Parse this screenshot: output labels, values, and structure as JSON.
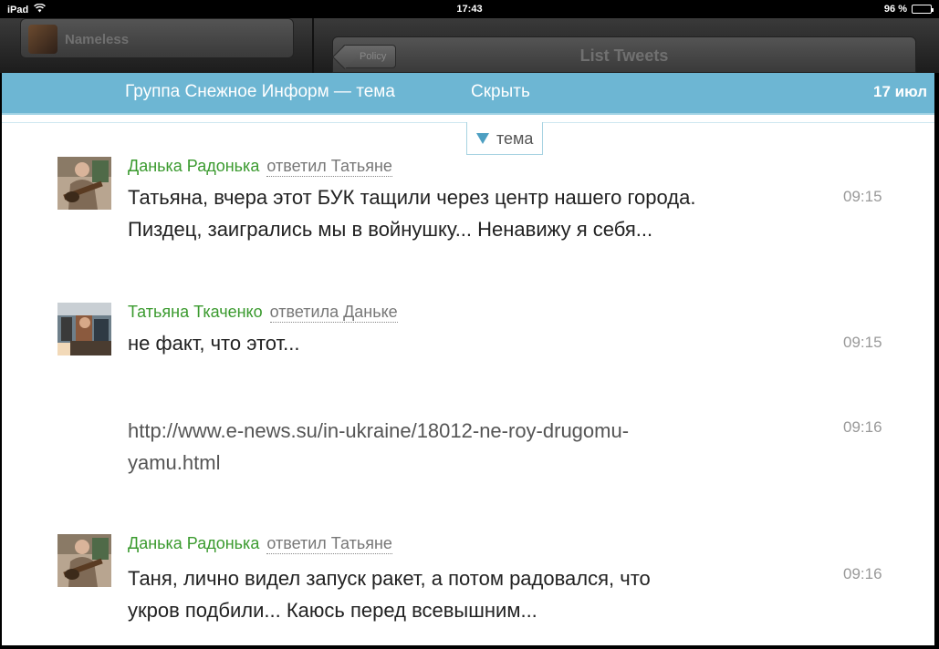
{
  "status_bar": {
    "device": "iPad",
    "time": "17:43",
    "battery": "96 %",
    "battery_level": 0.96
  },
  "background_app": {
    "left_pane_title": "Nameless",
    "back_button_label": "Policy",
    "right_pane_title": "List Tweets"
  },
  "popup": {
    "title": "Группа Снежное Информ — тема",
    "hide_label": "Скрыть",
    "date": "17 июл",
    "topic_tab_label": "тема"
  },
  "messages": [
    {
      "author": "Данька Радонька",
      "reply": "ответил Татьяне",
      "lines": [
        "Татьяна, вчера этот БУК тащили через центр нашего города.",
        "Пиздец, заигрались мы в войнушку... Ненавижу я себя..."
      ],
      "time": "09:15"
    },
    {
      "author": "Татьяна Ткаченко",
      "reply": "ответила Даньке",
      "lines": [
        "не факт, что этот..."
      ],
      "time": "09:15"
    },
    {
      "link_lines": [
        "http://www.e-news.su/in-ukraine/18012-ne-roy-drugomu-",
        "yamu.html"
      ],
      "time": "09:16"
    },
    {
      "author": "Данька Радонька",
      "reply": "ответил Татьяне",
      "lines": [
        "Таня, лично видел запуск ракет, а потом радовался, что",
        "укров подбили... Каюсь перед всевышним..."
      ],
      "time": "09:16"
    }
  ]
}
